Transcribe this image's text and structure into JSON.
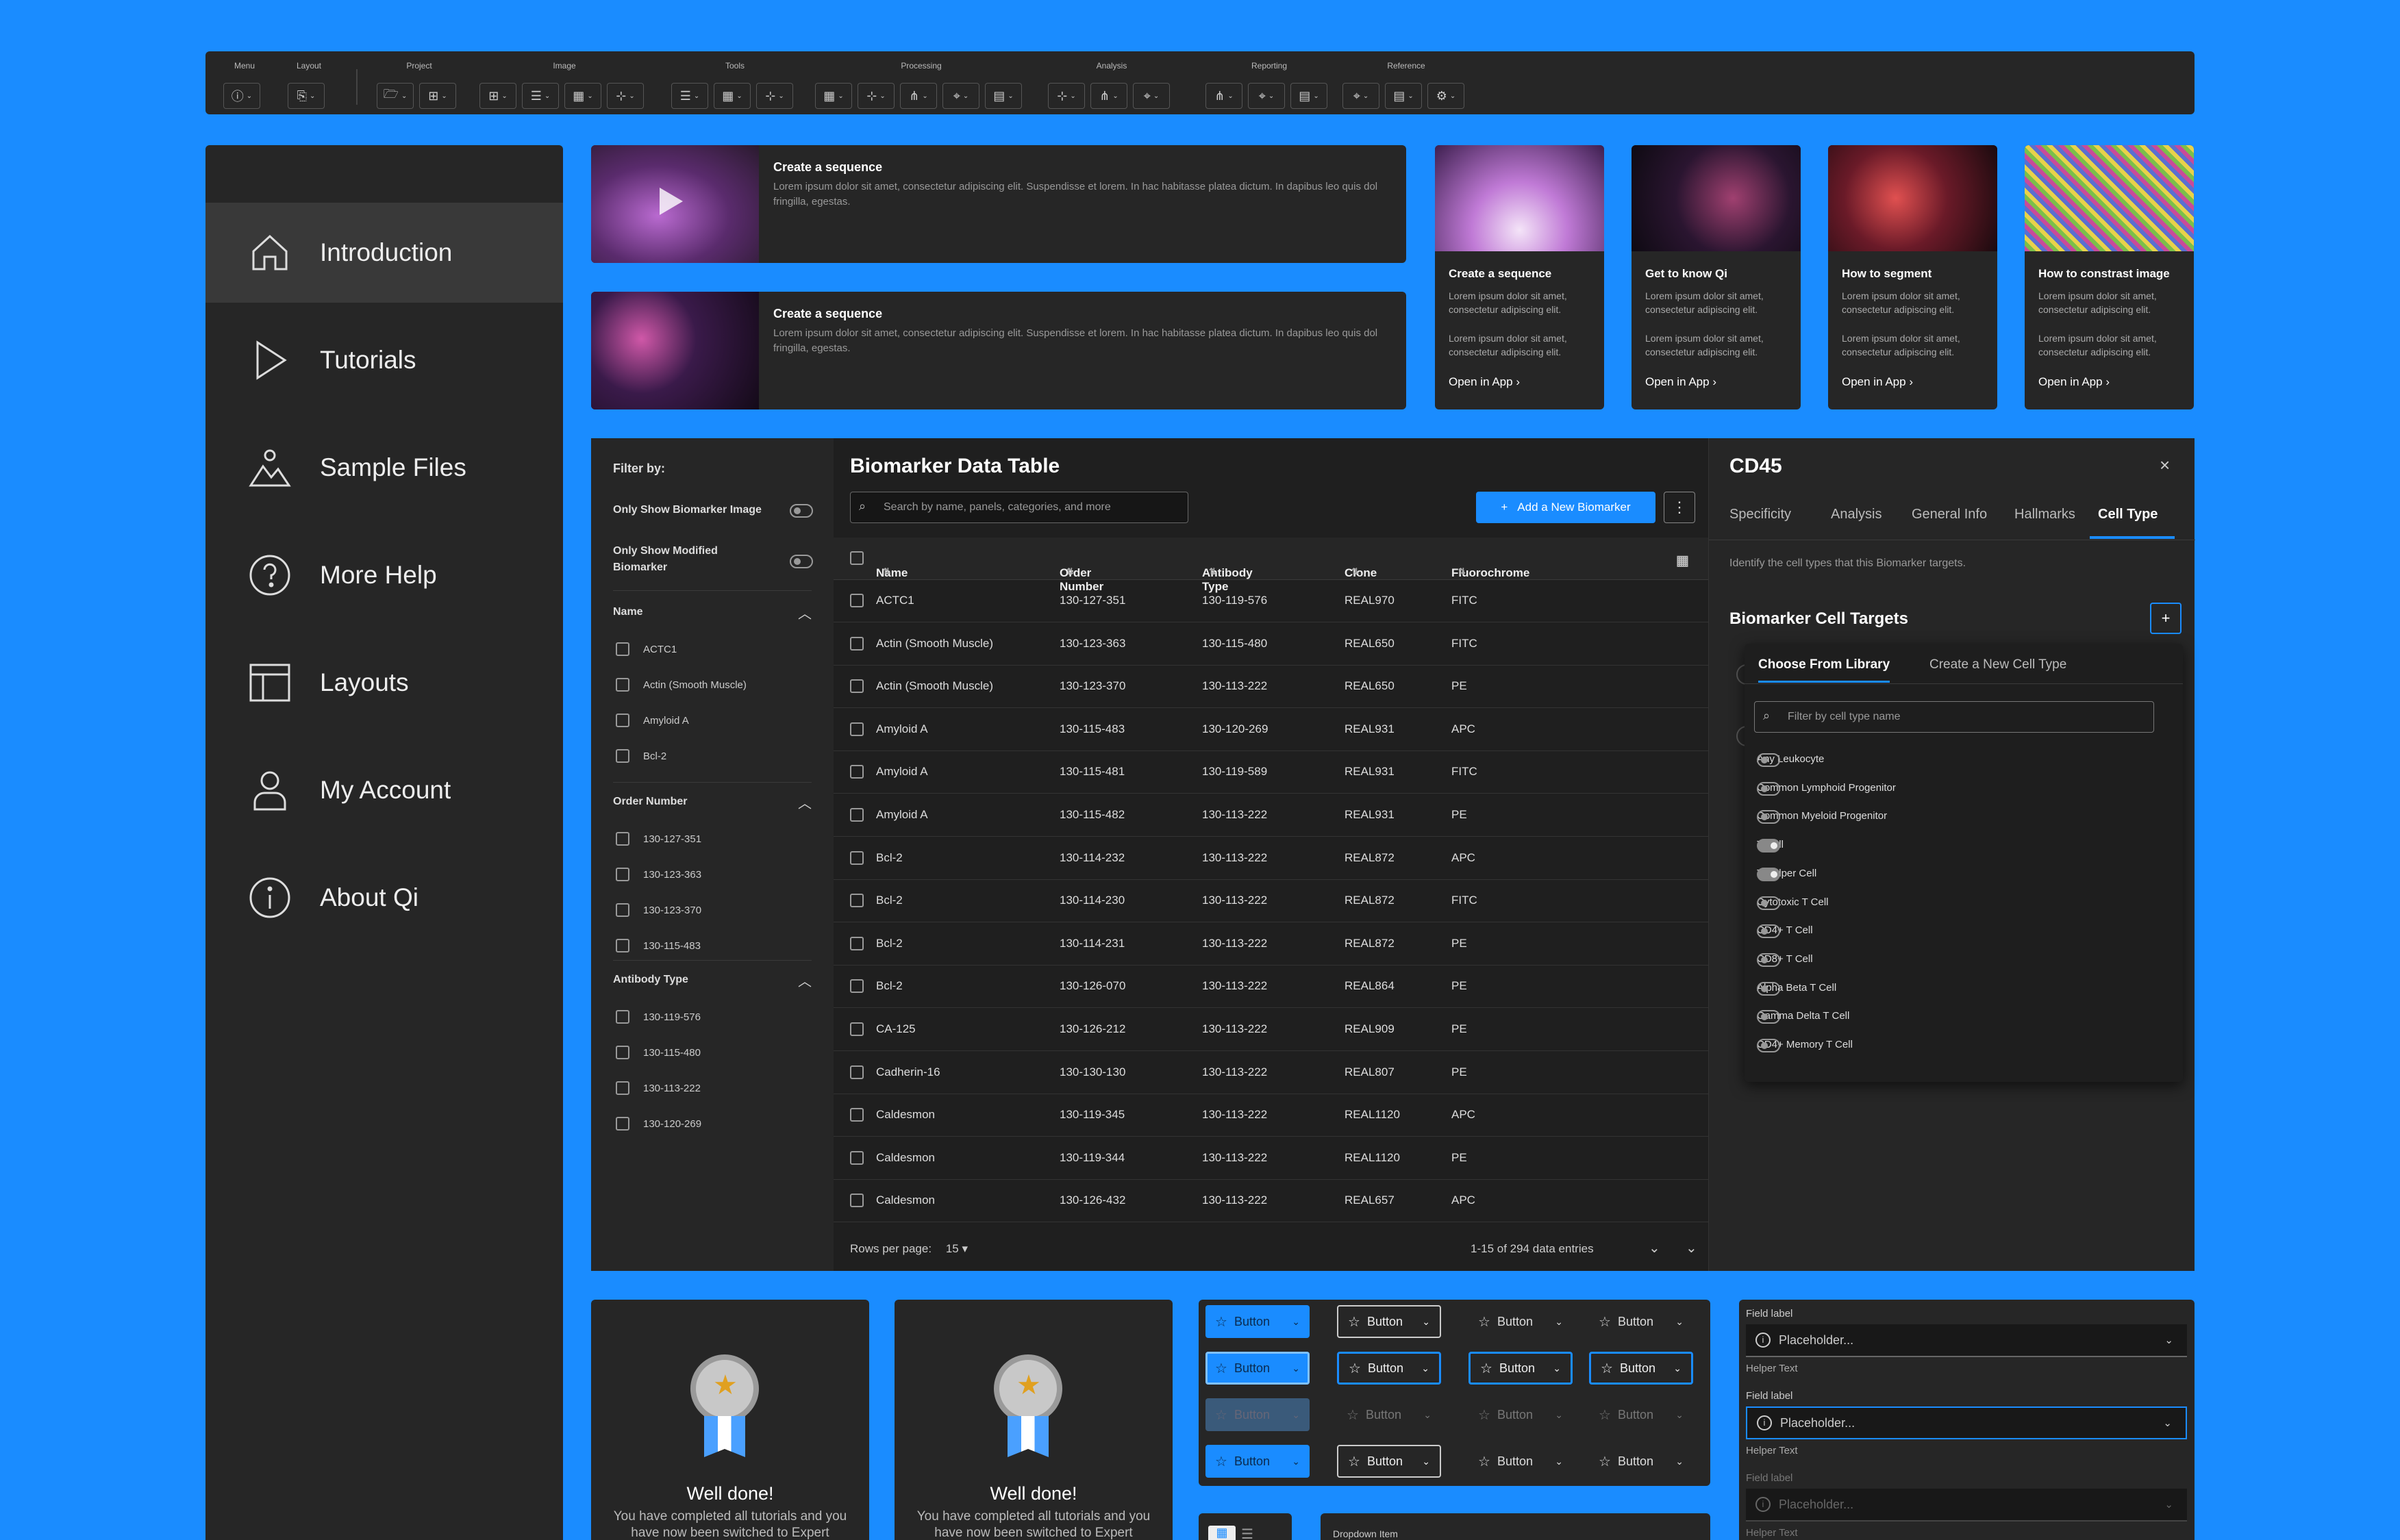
{
  "toolbar": {
    "groups": [
      {
        "label": "Menu"
      },
      {
        "label": "Layout"
      },
      {
        "label": "Project"
      },
      {
        "label": "Image"
      },
      {
        "label": "Tools"
      },
      {
        "label": "Processing"
      },
      {
        "label": "Analysis"
      },
      {
        "label": "Reporting"
      },
      {
        "label": "Reference"
      }
    ]
  },
  "sidebar": {
    "items": [
      {
        "label": "Introduction",
        "icon": "home-icon"
      },
      {
        "label": "Tutorials",
        "icon": "play-icon"
      },
      {
        "label": "Sample Files",
        "icon": "image-icon"
      },
      {
        "label": "More Help",
        "icon": "help-icon"
      },
      {
        "label": "Layouts",
        "icon": "layout-icon"
      },
      {
        "label": "My Account",
        "icon": "user-icon"
      },
      {
        "label": "About Qi",
        "icon": "info-icon"
      }
    ]
  },
  "videos": [
    {
      "title": "Create a sequence",
      "desc": "Lorem ipsum dolor sit amet, consectetur adipiscing elit. Suspendisse et lorem. In hac habitasse platea dictum. In dapibus leo quis dol fringilla, egestas."
    },
    {
      "title": "Create a sequence",
      "desc": "Lorem ipsum dolor sit amet, consectetur adipiscing elit. Suspendisse et lorem. In hac habitasse platea dictum. In dapibus leo quis dol fringilla, egestas."
    }
  ],
  "tutorials": [
    {
      "title": "Create a sequence",
      "desc1": "Lorem ipsum dolor sit amet, consectetur adipiscing elit.",
      "desc2": "Lorem ipsum dolor sit amet, consectetur adipiscing elit.",
      "link": "Open in App"
    },
    {
      "title": "Get to know Qi",
      "desc1": "Lorem ipsum dolor sit amet, consectetur adipiscing elit.",
      "desc2": "Lorem ipsum dolor sit amet, consectetur adipiscing elit.",
      "link": "Open in App"
    },
    {
      "title": "How to segment",
      "desc1": "Lorem ipsum dolor sit amet, consectetur adipiscing elit.",
      "desc2": "Lorem ipsum dolor sit amet, consectetur adipiscing elit.",
      "link": "Open in App"
    },
    {
      "title": "How to constrast image",
      "desc1": "Lorem ipsum dolor sit amet, consectetur adipiscing elit.",
      "desc2": "Lorem ipsum dolor sit amet, consectetur adipiscing elit.",
      "link": "Open in App"
    }
  ],
  "filters": {
    "title": "Filter by:",
    "toggle1": "Only Show Biomarker Image",
    "toggle2": "Only Show Modified Biomarker",
    "name_head": "Name",
    "name_items": [
      "ACTC1",
      "Actin (Smooth Muscle)",
      "Amyloid A",
      "Bcl-2"
    ],
    "order_head": "Order Number",
    "order_items": [
      "130-127-351",
      "130-123-363",
      "130-123-370",
      "130-115-483"
    ],
    "antibody_head": "Antibody Type",
    "antibody_items": [
      "130-119-576",
      "130-115-480",
      "130-113-222",
      "130-120-269"
    ]
  },
  "table": {
    "title": "Biomarker Data Table",
    "search_placeholder": "Search by name, panels, categories, and more",
    "add_button": "Add a New Biomarker",
    "columns": [
      "Name",
      "Order Number",
      "Antibody Type",
      "Clone",
      "Fluorochrome"
    ],
    "rows": [
      [
        "ACTC1",
        "130-127-351",
        "130-119-576",
        "REAL970",
        "FITC"
      ],
      [
        "Actin (Smooth Muscle)",
        "130-123-363",
        "130-115-480",
        "REAL650",
        "FITC"
      ],
      [
        "Actin (Smooth Muscle)",
        "130-123-370",
        "130-113-222",
        "REAL650",
        "PE"
      ],
      [
        "Amyloid A",
        "130-115-483",
        "130-120-269",
        "REAL931",
        "APC"
      ],
      [
        "Amyloid A",
        "130-115-481",
        "130-119-589",
        "REAL931",
        "FITC"
      ],
      [
        "Amyloid A",
        "130-115-482",
        "130-113-222",
        "REAL931",
        "PE"
      ],
      [
        "Bcl-2",
        "130-114-232",
        "130-113-222",
        "REAL872",
        "APC"
      ],
      [
        "Bcl-2",
        "130-114-230",
        "130-113-222",
        "REAL872",
        "FITC"
      ],
      [
        "Bcl-2",
        "130-114-231",
        "130-113-222",
        "REAL872",
        "PE"
      ],
      [
        "Bcl-2",
        "130-126-070",
        "130-113-222",
        "REAL864",
        "PE"
      ],
      [
        "CA-125",
        "130-126-212",
        "130-113-222",
        "REAL909",
        "PE"
      ],
      [
        "Cadherin-16",
        "130-130-130",
        "130-113-222",
        "REAL807",
        "PE"
      ],
      [
        "Caldesmon",
        "130-119-345",
        "130-113-222",
        "REAL1120",
        "APC"
      ],
      [
        "Caldesmon",
        "130-119-344",
        "130-113-222",
        "REAL1120",
        "PE"
      ],
      [
        "Caldesmon",
        "130-126-432",
        "130-113-222",
        "REAL657",
        "APC"
      ]
    ],
    "rows_per_page_label": "Rows per page:",
    "rows_per_page": "15",
    "pagination": "1-15 of 294 data entries"
  },
  "detail": {
    "title": "CD45",
    "tabs": [
      "Specificity",
      "Analysis",
      "General Info",
      "Hallmarks",
      "Cell Type"
    ],
    "desc": "Identify the cell types that this Biomarker targets.",
    "section": "Biomarker Cell Targets",
    "subtabs": [
      "Choose From Library",
      "Create a New Cell Type"
    ],
    "filter_placeholder": "Filter by cell type name",
    "cell_types": [
      {
        "name": "Any Leukocyte",
        "on": false
      },
      {
        "name": "Common Lymphoid Progenitor",
        "on": false
      },
      {
        "name": "Common Myeloid Progenitor",
        "on": false
      },
      {
        "name": "T Cell",
        "on": true
      },
      {
        "name": "T Helper Cell",
        "on": true
      },
      {
        "name": "Cytotoxic T Cell",
        "on": false
      },
      {
        "name": "CD4+ T Cell",
        "on": false
      },
      {
        "name": "CD8+ T Cell",
        "on": false
      },
      {
        "name": "Alpha Beta T Cell",
        "on": false
      },
      {
        "name": "Gamma Delta T Cell",
        "on": false
      },
      {
        "name": "CD4+ Memory T Cell",
        "on": false
      }
    ]
  },
  "badges": [
    {
      "title": "Well done!",
      "desc": "You have completed all tutorials and you have now been switched to Expert"
    },
    {
      "title": "Well done!",
      "desc": "You have completed all tutorials and you have now been switched to Expert"
    }
  ],
  "buttons": {
    "label": "Button"
  },
  "fields": {
    "label": "Field label",
    "placeholder": "Placeholder...",
    "helper": "Helper Text"
  },
  "bottom_tile": {
    "label": "Dropdown Item"
  },
  "colors": {
    "background": "#1a8cff",
    "panel": "#262626",
    "accent": "#1a8cff"
  }
}
